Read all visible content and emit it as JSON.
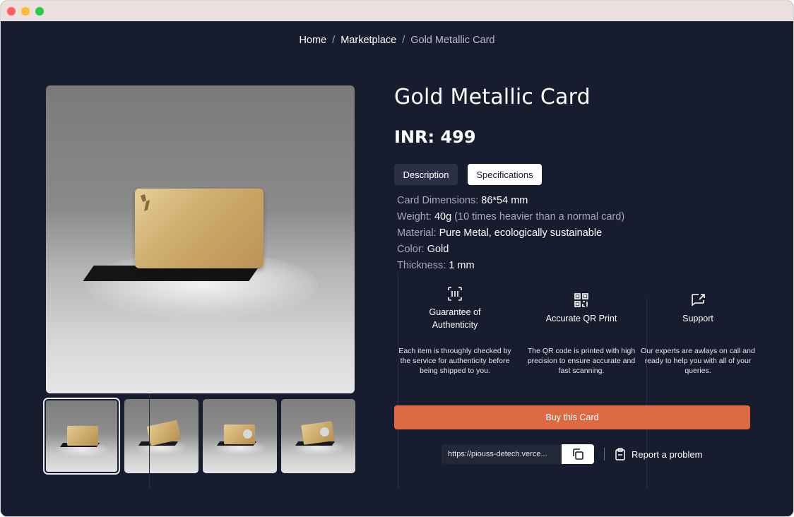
{
  "breadcrumb": {
    "home": "Home",
    "marketplace": "Marketplace",
    "current": "Gold Metallic Card",
    "separator": "/"
  },
  "product": {
    "title": "Gold Metallic Card",
    "price_label": "INR:",
    "price_value": "499"
  },
  "tabs": {
    "description": "Description",
    "specifications": "Specifications",
    "active": "Specifications"
  },
  "specs": [
    {
      "key": "Card Dimensions:",
      "value": "86*54 mm",
      "note": ""
    },
    {
      "key": "Weight:",
      "value": "40g",
      "note": "(10 times heavier than a normal card)"
    },
    {
      "key": "Material:",
      "value": "Pure Metal, ecologically sustainable",
      "note": ""
    },
    {
      "key": "Color:",
      "value": "Gold",
      "note": ""
    },
    {
      "key": "Thickness:",
      "value": "1 mm",
      "note": ""
    }
  ],
  "features": [
    {
      "icon": "scan-icon",
      "name": "Guarantee of Authenticity",
      "desc": "Each item is throughly checked by the service for authenticity before being shipped to you."
    },
    {
      "icon": "qr-code-icon",
      "name": "Accurate QR Print",
      "desc": "The QR code is printed with high precision to ensure accurate and fast scanning."
    },
    {
      "icon": "message-forward-icon",
      "name": "Support",
      "desc": "Our experts are awlays on call and ready to help you with all of your queries."
    }
  ],
  "actions": {
    "buy": "Buy this Card",
    "share_url": "https://piouss-detech.verce...",
    "report": "Report a problem"
  },
  "colors": {
    "background": "#181c2f",
    "accent": "#dd6a42",
    "gold": "#d2b175"
  }
}
